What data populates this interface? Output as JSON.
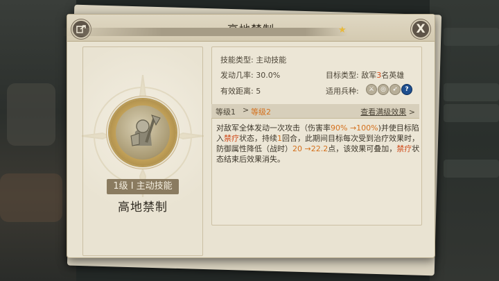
{
  "dialog": {
    "title": "高地禁制",
    "back_icon": "exit-icon",
    "close_label": "X"
  },
  "skill": {
    "badge": "1级 I 主动技能",
    "name": "高地禁制"
  },
  "info": {
    "type_label": "技能类型: 主动技能",
    "trigger_label": "发动几率: 30.0%",
    "target_label_prefix": "目标类型: 敌军",
    "target_count": "3",
    "target_label_suffix": "名英雄",
    "range_label": "有效距离: 5",
    "units_label": "适用兵种:",
    "unit_icons": [
      "cavalry-icon",
      "shield-icon",
      "archer-icon",
      "siege-icon"
    ]
  },
  "levels": {
    "current": "等级1",
    "arrow": ">",
    "next": "等级2",
    "view_max": "查看满级效果",
    "view_max_arrow": ">"
  },
  "description": {
    "p1": "对敌军全体发动一次攻击（伤害率",
    "dmg": "90% →100%",
    "p2": ")并使目标陷入",
    "status1": "禁疗",
    "p3": "状态，持续",
    "turns": "1",
    "p4": "回合，此期间目标每次受到治疗效果时，防御属性降低（战时）",
    "def": "20 →22.2",
    "p5": "点，该效果可叠加，",
    "status2": "禁疗",
    "p6": "状态结束后效果消失。"
  },
  "colors": {
    "accent_orange": "#d4701c",
    "accent_red": "#d04c1c",
    "panel": "#e9e3d2"
  }
}
